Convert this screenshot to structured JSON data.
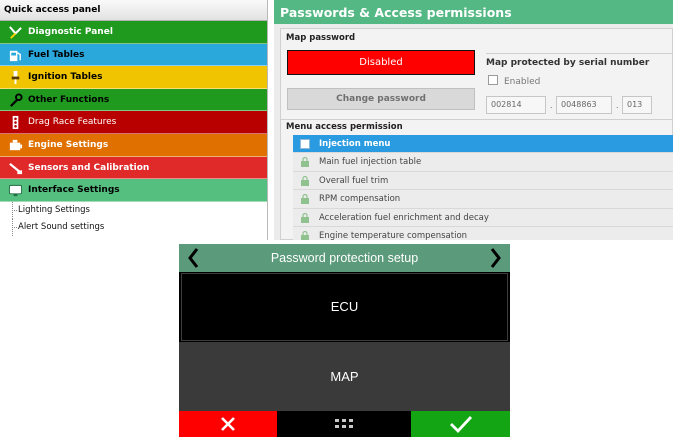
{
  "quick_access": {
    "title": "Quick access panel",
    "categories": [
      {
        "label": "Diagnostic Panel",
        "color": "#1f9a1f",
        "icon": "diagnostic-icon"
      },
      {
        "label": "Fuel Tables",
        "color": "#2aa8dc",
        "icon": "fuel-pump-icon"
      },
      {
        "label": "Ignition Tables",
        "color": "#f0c400",
        "icon": "spark-plug-icon"
      },
      {
        "label": "Other Functions",
        "color": "#1f9a1f",
        "icon": "wrench-icon"
      },
      {
        "label": "Drag Race Features",
        "color": "#b80000",
        "icon": "drag-tree-icon"
      },
      {
        "label": "Engine Settings",
        "color": "#e07000",
        "icon": "engine-icon"
      },
      {
        "label": "Sensors and Calibration",
        "color": "#e02a2a",
        "icon": "sensor-icon"
      },
      {
        "label": "Interface Settings",
        "color": "#55bf80",
        "icon": "monitor-icon"
      }
    ],
    "sub_items": [
      "Lighting Settings",
      "Alert Sound settings"
    ]
  },
  "passwords": {
    "title": "Passwords & Access permissions",
    "map_password_label": "Map password",
    "disabled_button": "Disabled",
    "change_password_button": "Change password",
    "serial_title": "Map protected by serial number",
    "serial_enabled_label": "Enabled",
    "serial": [
      "002814",
      "0048863",
      "013"
    ],
    "menu_access_label": "Menu access permission",
    "menu_items": [
      "Injection menu",
      "Main fuel injection table",
      "Overall fuel trim",
      "RPM compensation",
      "Acceleration fuel enrichment and decay",
      "Engine temperature compensation"
    ]
  },
  "device": {
    "title": "Password protection setup",
    "options": [
      "ECU",
      "MAP"
    ],
    "footer": {
      "cancel_icon": "close-icon",
      "menu_icon": "grid-icon",
      "confirm_icon": "checkmark-icon"
    },
    "colors": {
      "header": "#5b9a7a",
      "cancel": "#ff0000",
      "confirm": "#14a514"
    }
  }
}
